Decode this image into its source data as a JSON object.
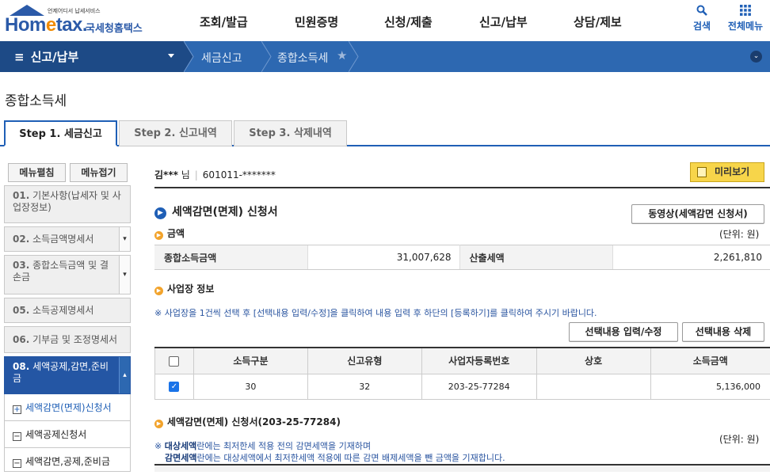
{
  "header": {
    "logo_small": "언제어디서 납세서비스",
    "logo_home": "Hom",
    "logo_e": "e",
    "logo_tax": "tax.",
    "logo_kor": "국세청홈택스",
    "nav": [
      "조회/발급",
      "민원증명",
      "신청/제출",
      "신고/납부",
      "상담/제보"
    ],
    "search_label": "검색",
    "allmenu_label": "전체메뉴"
  },
  "breadcrumb": {
    "menu": "신고/납부",
    "items": [
      "세금신고",
      "종합소득세"
    ]
  },
  "page_title": "종합소득세",
  "tabs": [
    "Step 1. 세금신고",
    "Step 2. 신고내역",
    "Step 3. 삭제내역"
  ],
  "left_menu": {
    "edit_label": "메뉴펼침",
    "fold_label": "메뉴접기",
    "items": [
      {
        "num": "01.",
        "label": "기본사항(납세자 및 사업장정보)"
      },
      {
        "num": "02.",
        "label": "소득금액명세서"
      },
      {
        "num": "03.",
        "label": "종합소득금액 및 결손금"
      },
      {
        "num": "05.",
        "label": "소득공제명세서"
      },
      {
        "num": "06.",
        "label": "기부금 및 조정명세서"
      },
      {
        "num": "08.",
        "label": "세액공제,감면,준비금"
      }
    ],
    "sub_items": [
      "세액감면(면제)신청서",
      "세액공제신청서",
      "세액감면,공제,준비금"
    ]
  },
  "user": {
    "name": "김***",
    "honorific": "님",
    "id": "601011-*******"
  },
  "preview_label": "미리보기",
  "section_title": "세액감면(면제) 신청서",
  "video_button": "동영상(세액감면 신청서)",
  "amount": {
    "title": "금액",
    "unit": "(단위: 원)",
    "total_income_label": "종합소득금액",
    "total_income_value": "31,007,628",
    "calc_tax_label": "산출세액",
    "calc_tax_value": "2,261,810"
  },
  "business": {
    "title": "사업장 정보",
    "note": "※ 사업장을 1건씩 선택 후 [선택내용 입력/수정]을 클릭하여 내용 입력 후 하단의 [등록하기]를 클릭하여 주시기 바랍니다.",
    "edit_button": "선택내용 입력/수정",
    "delete_button": "선택내용 삭제",
    "columns": [
      "소득구분",
      "신고유형",
      "사업자등록번호",
      "상호",
      "소득금액"
    ],
    "rows": [
      {
        "income_type": "30",
        "report_type": "32",
        "reg_no": "203-25-77284",
        "name": "",
        "income": "5,136,000"
      }
    ]
  },
  "reduction": {
    "title": "세액감면(면제) 신청서(203-25-77284)",
    "unit": "(단위: 원)",
    "note1_bold": "대상세액",
    "note1_rest": "란에는 최저한세 적용 전의 감면세액을 기재하며",
    "note2_bold": "감면세액",
    "note2_rest": "란에는 대상세액에서 최저한세액 적용에 따른 감면 배제세액을 뺀 금액을 기재합니다.",
    "note_prefix": "※ "
  }
}
